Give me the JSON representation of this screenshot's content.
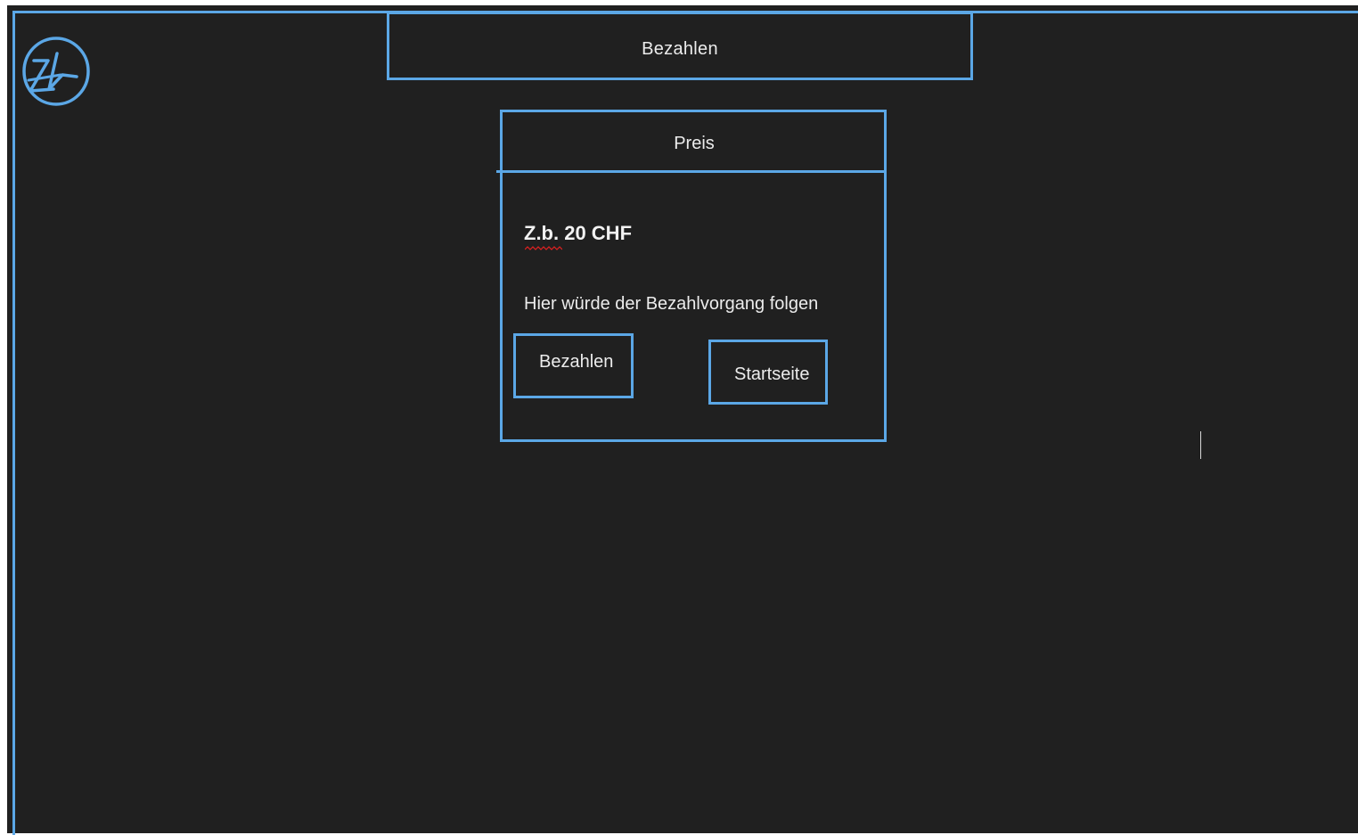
{
  "header": {
    "title": "Bezahlen"
  },
  "logo": {
    "icon": "handwritten-signature-logo",
    "color": "#5ba7e6"
  },
  "payment_panel": {
    "title": "Preis",
    "price": "Z.b. 20 CHF",
    "hint": "Hier würde der Bezahlvorgang folgen",
    "pay_button_label": "Bezahlen",
    "home_button_label": "Startseite"
  },
  "colors": {
    "background": "#202020",
    "accent": "#5ba7e6",
    "text": "#ececec",
    "spellcheck_underline": "#e02020"
  }
}
